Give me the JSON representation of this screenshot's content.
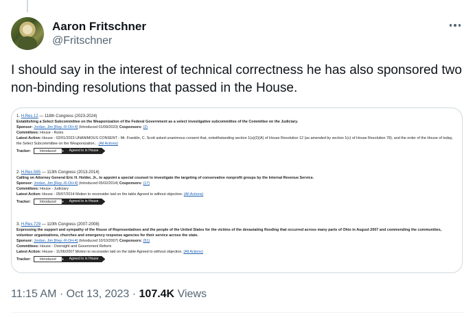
{
  "author": {
    "name": "Aaron Fritschner",
    "handle": "@Fritschner"
  },
  "tweet": {
    "text": "I should say in the interest of technical correctness he has also sponsored two non-binding resolutions that passed in the House."
  },
  "image_entries": [
    {
      "num": "1.",
      "bill": "H.Res.12",
      "congress": "— 118th Congress (2023-2024)",
      "title": "Establishing a Select Subcommittee on the Weaponization of the Federal Government as a select investigative subcommittee of the Committee on the Judiciary.",
      "sponsor_label": "Sponsor:",
      "sponsor": "Jordan, Jim [Rep.-R-OH-4]",
      "introduced": "(Introduced 01/09/2023)",
      "cosponsors_label": "Cosponsors:",
      "cosponsors": "(2)",
      "committees_label": "Committees:",
      "committees": "House - Rules",
      "action_label": "Latest Action:",
      "action": "House - 02/01/2023 UNANIMOUS CONSENT - Mr. Franklin, C. Scott asked unanimous consent that, notwithstanding section 1(a)(2)(A) of House Resolution 12 (as amended by section 1(c) of House Resolution 78), and the order of the House of today, the Select Subcommittee on the Weaponization...",
      "all_actions": "(All Actions)",
      "tracker_label": "Tracker:",
      "stage1": "Introduced",
      "stage2": "Agreed to in House"
    },
    {
      "num": "2.",
      "bill": "H.Res.565",
      "congress": "— 113th Congress (2013-2014)",
      "title": "Calling on Attorney General Eric H. Holder, Jr., to appoint a special counsel to investigate the targeting of conservative nonprofit groups by the Internal Revenue Service.",
      "sponsor_label": "Sponsor:",
      "sponsor": "Jordan, Jim [Rep.-R-OH-4]",
      "introduced": "(Introduced 05/02/2014)",
      "cosponsors_label": "Cosponsors:",
      "cosponsors": "(17)",
      "committees_label": "Committees:",
      "committees": "House - Judiciary",
      "action_label": "Latest Action:",
      "action": "House - 05/07/2014 Motion to reconsider laid on the table Agreed to without objection.",
      "all_actions": "(All Actions)",
      "tracker_label": "Tracker:",
      "stage1": "Introduced",
      "stage2": "Agreed to in House"
    },
    {
      "num": "3.",
      "bill": "H.Res.729",
      "congress": "— 110th Congress (2007-2008)",
      "title": "Expressing the support and sympathy of the House of Representatives and the people of the United States for the victims of the devastating flooding that occurred across many parts of Ohio in August 2007 and commending the communities, volunteer organizations, churches and emergency response agencies for their service across the state.",
      "sponsor_label": "Sponsor:",
      "sponsor": "Jordan, Jim [Rep.-R-OH-4]",
      "introduced": "(Introduced 10/10/2007)",
      "cosponsors_label": "Cosponsors:",
      "cosponsors": "(51)",
      "committees_label": "Committees:",
      "committees": "House - Oversight and Government Reform",
      "action_label": "Latest Action:",
      "action": "House - 11/06/2007 Motion to reconsider laid on the table Agreed to without objection.",
      "all_actions": "(All Actions)",
      "tracker_label": "Tracker:",
      "stage1": "Introduced",
      "stage2": "Agreed to in House"
    }
  ],
  "meta": {
    "time": "11:15 AM",
    "sep1": "·",
    "date": "Oct 13, 2023",
    "sep2": "·",
    "views_count": "107.4K",
    "views_label": "Views"
  },
  "icons": {
    "more": "more-horizontal-icon"
  }
}
